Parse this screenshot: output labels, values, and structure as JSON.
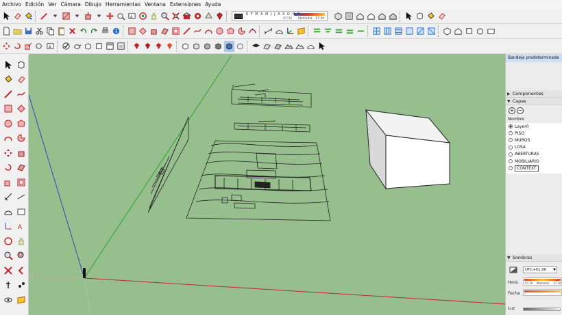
{
  "menu": [
    "Archivo",
    "Edición",
    "Ver",
    "Cámara",
    "Dibujo",
    "Herramientas",
    "Ventana",
    "Extensiones",
    "Ayuda"
  ],
  "shadow_strip": {
    "months": "E F M A M J J A S O N D",
    "time_start": "07:30",
    "time_mid": "Mediodía",
    "time_end": "17:30"
  },
  "right_panel": {
    "tray_title": "Bandeja predeterminada",
    "componentes": "Componentes",
    "capas": "Capas",
    "column_header": "Nombre",
    "layers": [
      {
        "name": "Layer0",
        "active": true
      },
      {
        "name": "PISO",
        "active": false
      },
      {
        "name": "MUROS",
        "active": false
      },
      {
        "name": "LOSA",
        "active": false
      },
      {
        "name": "ABERTURAS",
        "active": false
      },
      {
        "name": "MOBILIARIO",
        "active": false
      },
      {
        "name": "CONTEXT",
        "active": false,
        "editing": true
      }
    ],
    "sombras": {
      "title": "Sombras",
      "timezone": "UTC+01:00",
      "hora_label": "Hora",
      "fecha_label": "Fecha",
      "luz_label": "Luz",
      "time_start": "07:30",
      "time_mid": "Mediodía",
      "time_end": "17:30"
    }
  },
  "colors": {
    "viewport_bg": "#97bf8d",
    "axis_red": "#c0262b",
    "axis_green": "#2ea42e",
    "axis_blue": "#3544b8"
  }
}
